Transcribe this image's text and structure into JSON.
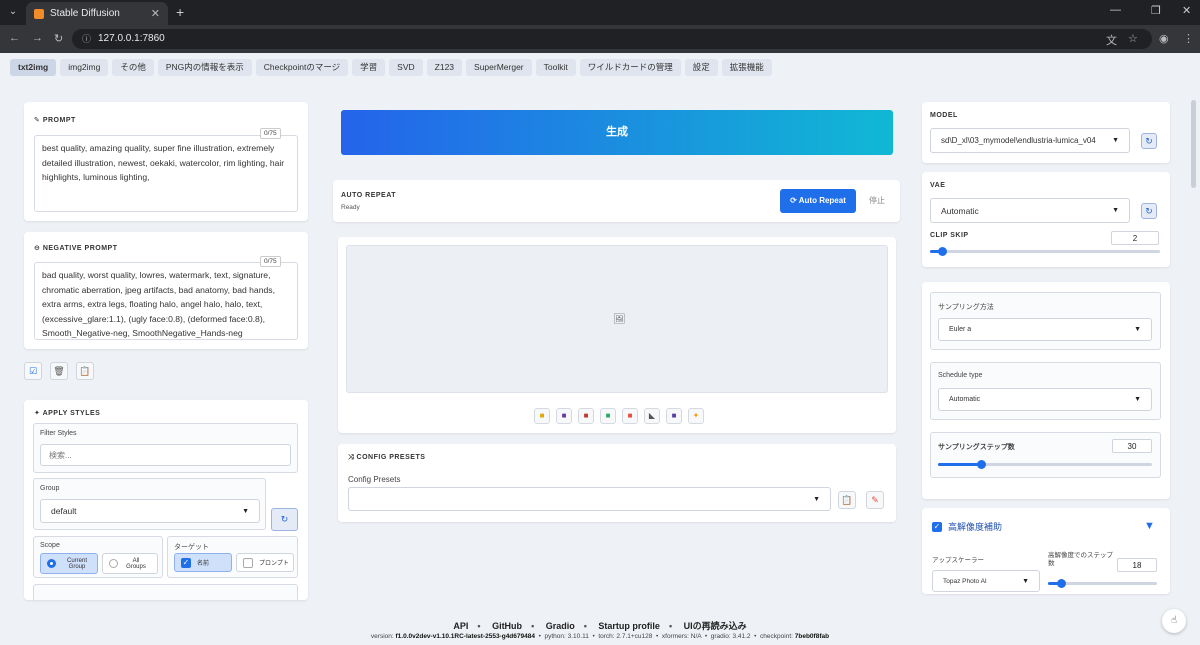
{
  "browser": {
    "tab_title": "Stable Diffusion",
    "url": "127.0.0.1:7860",
    "tab_close": "✕",
    "new_tab": "+",
    "window_controls": [
      "—",
      "❐",
      "✕"
    ]
  },
  "nav_tabs": [
    "txt2img",
    "img2img",
    "その他",
    "PNG内の情報を表示",
    "Checkpointのマージ",
    "学習",
    "SVD",
    "Z123",
    "SuperMerger",
    "Toolkit",
    "ワイルドカードの管理",
    "設定",
    "拡張機能"
  ],
  "prompt": {
    "title": "PROMPT",
    "counter": "0/75",
    "text": "best quality, amazing quality, super fine illustration, extremely detailed illustration, newest, oekaki, watercolor, rim lighting, hair highlights, luminous lighting,"
  },
  "negative_prompt": {
    "title": "NEGATIVE PROMPT",
    "counter": "0/75",
    "text": "bad quality, worst quality, lowres, watermark, text, signature, chromatic aberration, jpeg artifacts, bad anatomy, bad hands, extra arms, extra legs, floating halo, angel halo, halo, text, (excessive_glare:1.1), (ugly face:0.8), (deformed face:0.8), Smooth_Negative-neg, SmoothNegative_Hands-neg"
  },
  "apply_styles": {
    "title": "APPLY STYLES",
    "filter_label": "Filter Styles",
    "filter_placeholder": "検索...",
    "group_label": "Group",
    "group_value": "default",
    "scope_label": "Scope",
    "scope_options": [
      "Current Group",
      "All Groups"
    ],
    "target_label": "ターゲット",
    "target_options": [
      "名前",
      "プロンプト"
    ]
  },
  "generate": {
    "label": "生成"
  },
  "auto_repeat": {
    "title": "AUTO REPEAT",
    "status": "Ready",
    "button": "Auto Repeat",
    "stop": "停止"
  },
  "config_presets": {
    "title": "CONFIG PRESETS",
    "label": "Config Presets",
    "value": ""
  },
  "model": {
    "label": "MODEL",
    "value": "sd\\D_xl\\03_mymodel\\endlustria-lumica_v04"
  },
  "vae": {
    "label": "VAE",
    "value": "Automatic"
  },
  "clip_skip": {
    "label": "CLIP SKIP",
    "value": "2",
    "fraction": 0.05
  },
  "sampling": {
    "method_label": "サンプリング方法",
    "method_value": "Euler a",
    "schedule_label": "Schedule type",
    "schedule_value": "Automatic",
    "steps_label": "サンプリングステップ数",
    "steps_value": "30",
    "steps_fraction": 0.2
  },
  "hires": {
    "label": "高解像度補助",
    "upscaler_label": "アップスケーラー",
    "upscaler_value": "Topaz Photo AI",
    "steps_label": "高解像度でのステップ数",
    "steps_value": "18",
    "steps_fraction": 0.12
  },
  "footer": {
    "links": [
      "API",
      "GitHub",
      "Gradio",
      "Startup profile",
      "UIの再読み込み"
    ],
    "version_label": "version:",
    "version": "f1.0.0v2dev-v1.10.1RC-latest-2553-g4d679484",
    "python_label": "python:",
    "python": "3.10.11",
    "torch_label": "torch:",
    "torch": "2.7.1+cu128",
    "xformers_label": "xformers:",
    "xformers": "N/A",
    "gradio_label": "gradio:",
    "gradio": "3.41.2",
    "checkpoint_label": "checkpoint:",
    "checkpoint": "7beb0f8fab"
  },
  "colors": {
    "accent": "#1f6feb",
    "gradient_end": "#10b8d4",
    "background": "#eef1f6"
  }
}
